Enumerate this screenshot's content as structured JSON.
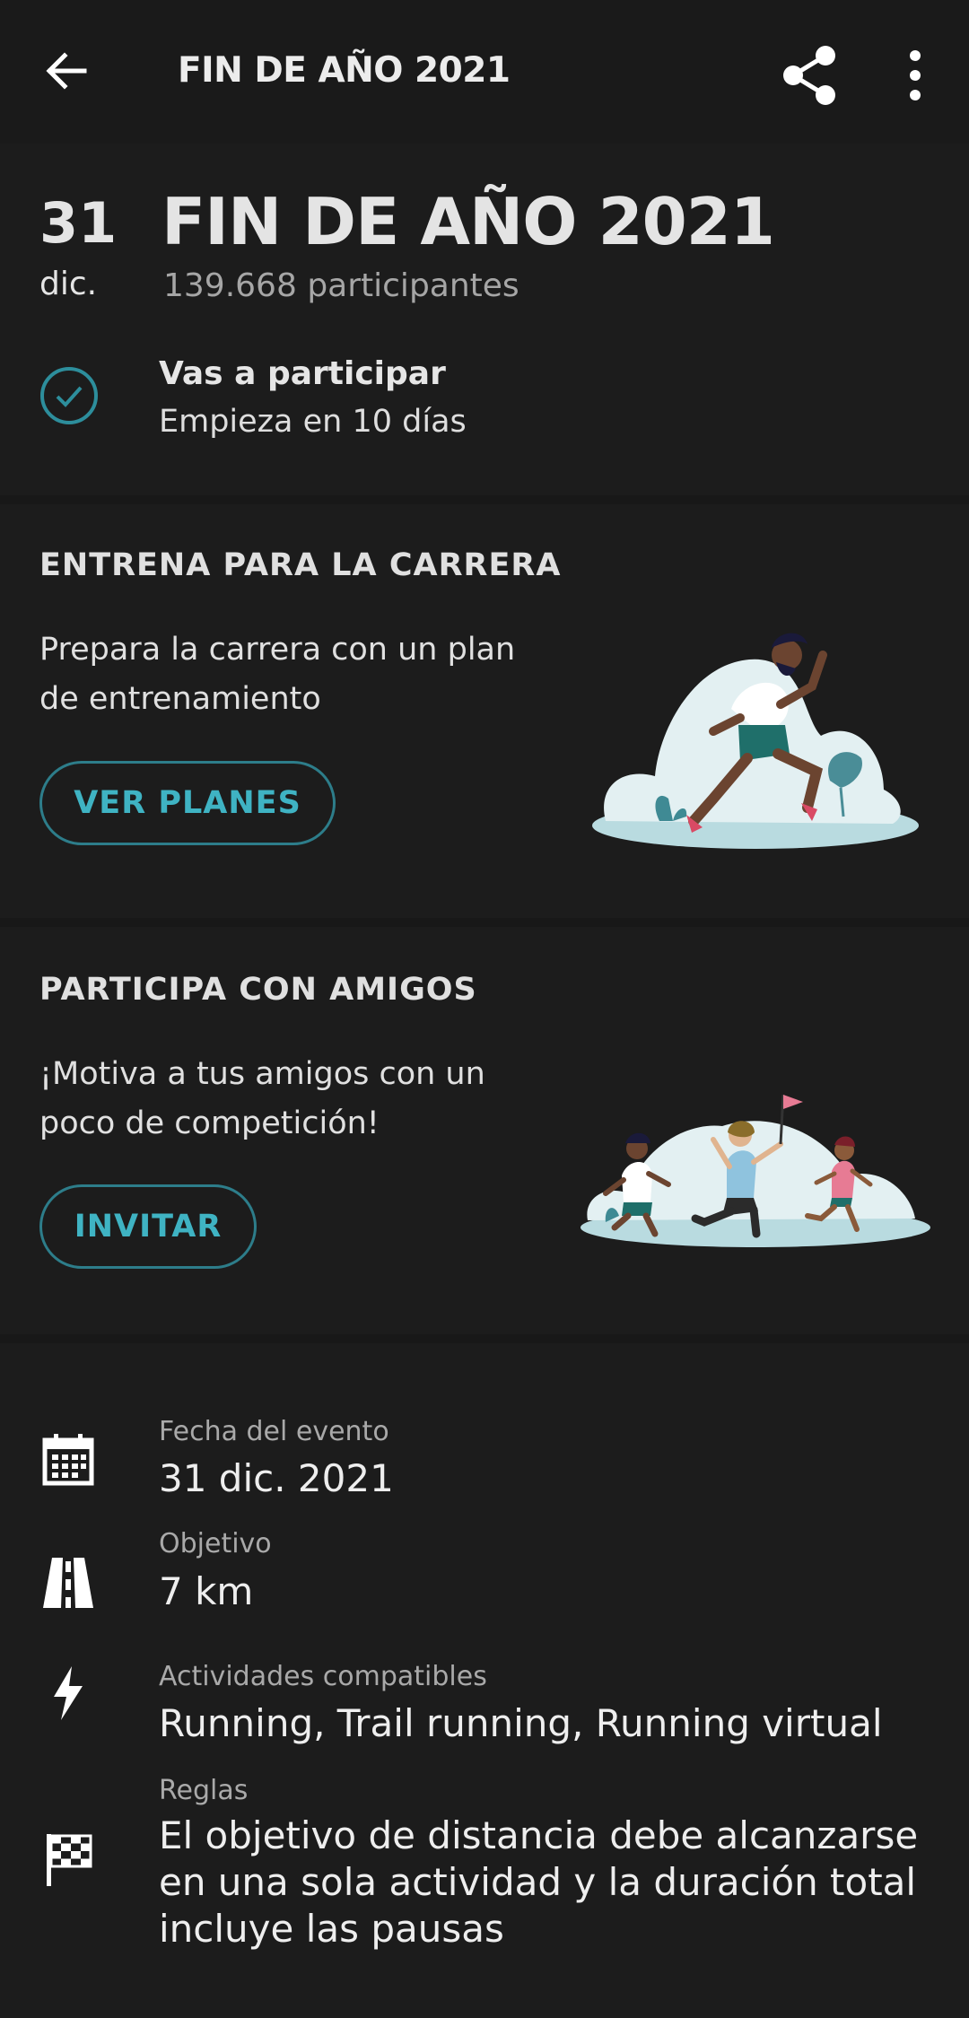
{
  "header": {
    "title": "FIN DE AÑO 2021",
    "back_icon": "arrow-left-icon",
    "share_icon": "share-icon",
    "more_icon": "more-vert-icon"
  },
  "event": {
    "day": "31",
    "month": "dic.",
    "title": "FIN DE AÑO 2021",
    "participants": "139.668 participantes"
  },
  "status": {
    "title": "Vas a participar",
    "subtitle": "Empieza en 10 días",
    "icon": "check-circle-icon"
  },
  "train": {
    "heading": "ENTRENA PARA LA CARRERA",
    "text": "Prepara la carrera con un plan de entrenamiento",
    "button": "VER PLANES"
  },
  "friends": {
    "heading": "PARTICIPA CON AMIGOS",
    "text": "¡Motiva a tus amigos con un poco de competición!",
    "button": "INVITAR"
  },
  "details": [
    {
      "label": "Fecha del evento",
      "value": "31 dic. 2021",
      "icon": "calendar-icon"
    },
    {
      "label": "Objetivo",
      "value": "7 km",
      "icon": "road-icon"
    },
    {
      "label": "Actividades compatibles",
      "value": "Running, Trail running, Running virtual",
      "icon": "lightning-icon"
    },
    {
      "label": "Reglas",
      "value": "El objetivo de distancia debe alcanzarse en una sola actividad y la duración total incluye las pausas",
      "icon": "checkered-flag-icon"
    }
  ],
  "colors": {
    "background": "#1c1c1c",
    "accent": "#3fb3c3",
    "accent_border": "#2d7d8a"
  }
}
